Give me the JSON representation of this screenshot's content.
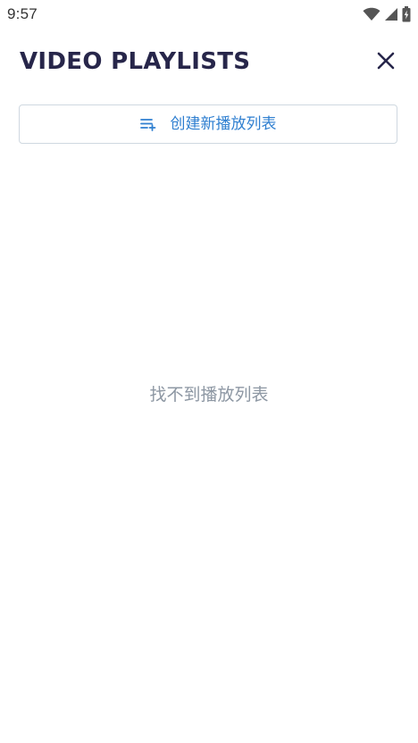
{
  "status_bar": {
    "time": "9:57",
    "icons": [
      "wifi-icon",
      "signal-icon",
      "battery-icon"
    ]
  },
  "header": {
    "title": "VIDEO PLAYLISTS",
    "close_icon": "close-icon"
  },
  "create_button": {
    "label": "创建新播放列表",
    "icon": "playlist-add-icon"
  },
  "empty_state": {
    "message": "找不到播放列表"
  },
  "colors": {
    "title": "#27264a",
    "accent": "#2f7fd0",
    "muted_text": "#8d97a3",
    "border": "#cfd8e0"
  }
}
